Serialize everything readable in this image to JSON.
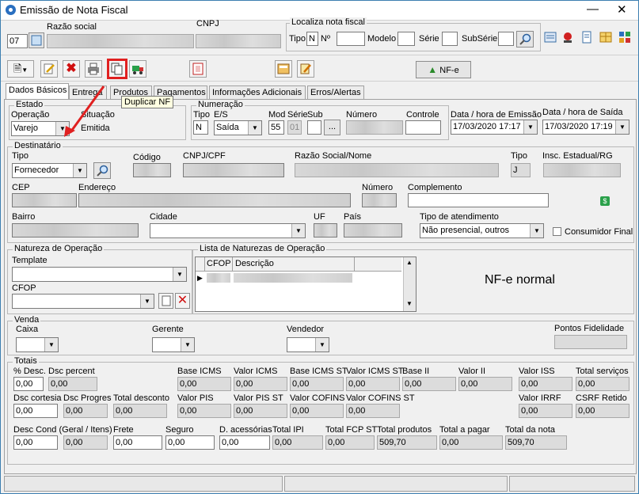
{
  "window": {
    "title": "Emissão de Nota Fiscal"
  },
  "header": {
    "code": "07",
    "razao_label": "Razão social",
    "cnpj_label": "CNPJ",
    "localiza": {
      "legend": "Localiza nota fiscal",
      "tipo_label": "Tipo",
      "tipo_value": "N",
      "num_label": "Nº",
      "modelo_label": "Modelo",
      "serie_label": "Série",
      "subserie_label": "SubSérie"
    }
  },
  "toolbar": {
    "nfe_label": "NF-e"
  },
  "tooltip": "Duplicar NF",
  "tabs": [
    "Dados Básicos",
    "Entrega",
    "Produtos",
    "Pagamentos",
    "Informações Adicionais",
    "Erros/Alertas"
  ],
  "estado": {
    "legend": "Estado",
    "operacao_label": "Operação",
    "operacao_value": "Varejo",
    "situacao_label": "Situação",
    "situacao_value": "Emitida"
  },
  "numeracao": {
    "legend": "Numeração",
    "tipo_label": "Tipo",
    "tipo_value": "N",
    "es_label": "E/S",
    "es_value": "Saída",
    "mod_label": "Mod",
    "mod_value": "55",
    "serie_label": "Série",
    "serie_value": "01",
    "sub_label": "Sub",
    "numero_label": "Número",
    "controle_label": "Controle",
    "ellipsis": "..."
  },
  "datas": {
    "emissao_label": "Data / hora de Emissão",
    "emissao_value": "17/03/2020 17:17",
    "saida_label": "Data / hora de Saída",
    "saida_value": "17/03/2020 17:19"
  },
  "destinatario": {
    "legend": "Destinatário",
    "tipo_label": "Tipo",
    "tipo_value": "Fornecedor",
    "codigo_label": "Código",
    "cpf_label": "CNPJ/CPF",
    "razao_label": "Razão Social/Nome",
    "tipo2_label": "Tipo",
    "tipo2_value": "J",
    "insc_label": "Insc. Estadual/RG",
    "cep_label": "CEP",
    "endereco_label": "Endereço",
    "numero_label": "Número",
    "complemento_label": "Complemento",
    "bairro_label": "Bairro",
    "cidade_label": "Cidade",
    "uf_label": "UF",
    "pais_label": "País",
    "atendimento_label": "Tipo de atendimento",
    "atendimento_value": "Não presencial, outros",
    "consumidor_label": "Consumidor Final"
  },
  "natureza": {
    "legend": "Natureza de Operação",
    "template_label": "Template",
    "cfop_label": "CFOP"
  },
  "lista": {
    "legend": "Lista de Naturezas de Operação",
    "columns": [
      "CFOP",
      "Descrição"
    ]
  },
  "nfe_status": "NF-e normal",
  "venda": {
    "legend": "Venda",
    "caixa_label": "Caixa",
    "gerente_label": "Gerente",
    "vendedor_label": "Vendedor",
    "pontos_label": "Pontos Fidelidade"
  },
  "totais": {
    "legend": "Totais",
    "fields": [
      {
        "label": "% Desc.",
        "value": "0,00"
      },
      {
        "label": "Dsc percent",
        "value": "0,00"
      },
      {
        "label": "Base ICMS",
        "value": "0,00"
      },
      {
        "label": "Valor ICMS",
        "value": "0,00"
      },
      {
        "label": "Base ICMS ST",
        "value": "0,00"
      },
      {
        "label": "Valor ICMS ST",
        "value": "0,00"
      },
      {
        "label": "Base II",
        "value": "0,00"
      },
      {
        "label": "Valor II",
        "value": "0,00"
      },
      {
        "label": "Valor ISS",
        "value": "0,00"
      },
      {
        "label": "Total serviços",
        "value": "0,00"
      },
      {
        "label": "Dsc cortesia",
        "value": "0,00"
      },
      {
        "label": "Dsc Progres",
        "value": "0,00"
      },
      {
        "label": "Total desconto",
        "value": "0,00"
      },
      {
        "label": "Valor PIS",
        "value": "0,00"
      },
      {
        "label": "Valor PIS ST",
        "value": "0,00"
      },
      {
        "label": "Valor COFINS",
        "value": "0,00"
      },
      {
        "label": "Valor COFINS ST",
        "value": "0,00"
      },
      {
        "label": "Valor IRRF",
        "value": "0,00"
      },
      {
        "label": "CSRF Retido",
        "value": "0,00"
      },
      {
        "label": "Desc Cond (Geral / Itens)",
        "value": "0,00"
      },
      {
        "label": "",
        "value": "0,00"
      },
      {
        "label": "Frete",
        "value": "0,00"
      },
      {
        "label": "Seguro",
        "value": "0,00"
      },
      {
        "label": "D. acessórias",
        "value": "0,00"
      },
      {
        "label": "Total IPI",
        "value": "0,00"
      },
      {
        "label": "Total FCP ST",
        "value": "0,00"
      },
      {
        "label": "Total produtos",
        "value": "509,70"
      },
      {
        "label": "Total a pagar",
        "value": "0,00"
      },
      {
        "label": "Total da nota",
        "value": "509,70"
      }
    ]
  },
  "colors": {
    "accent": "#e02020",
    "title_border": "#3c7fb1"
  }
}
